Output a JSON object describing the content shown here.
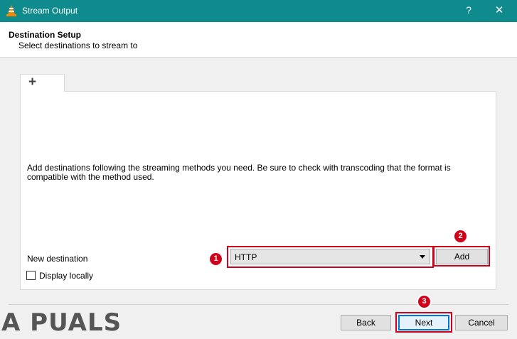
{
  "window": {
    "title": "Stream Output",
    "help_glyph": "?",
    "close_glyph": "✕",
    "icon": "vlc-cone-icon"
  },
  "header": {
    "title": "Destination Setup",
    "subtitle": "Select destinations to stream to"
  },
  "tab": {
    "label": "+"
  },
  "panel": {
    "description": "Add destinations following the streaming methods you need. Be sure to check with transcoding that the format is compatible with the method used.",
    "new_destination_label": "New destination",
    "destination_select": {
      "value": "HTTP"
    },
    "add_label": "Add",
    "display_locally_label": "Display locally",
    "display_locally_checked": false
  },
  "footer": {
    "back_label": "Back",
    "next_label": "Next",
    "cancel_label": "Cancel"
  },
  "annotations": {
    "marker_1": "1",
    "marker_2": "2",
    "marker_3": "3",
    "highlight_color": "#d0021b"
  },
  "watermark": {
    "text": "A PUALS"
  },
  "colors": {
    "titlebar": "#0f8b8d",
    "accent": "#0078d7"
  }
}
